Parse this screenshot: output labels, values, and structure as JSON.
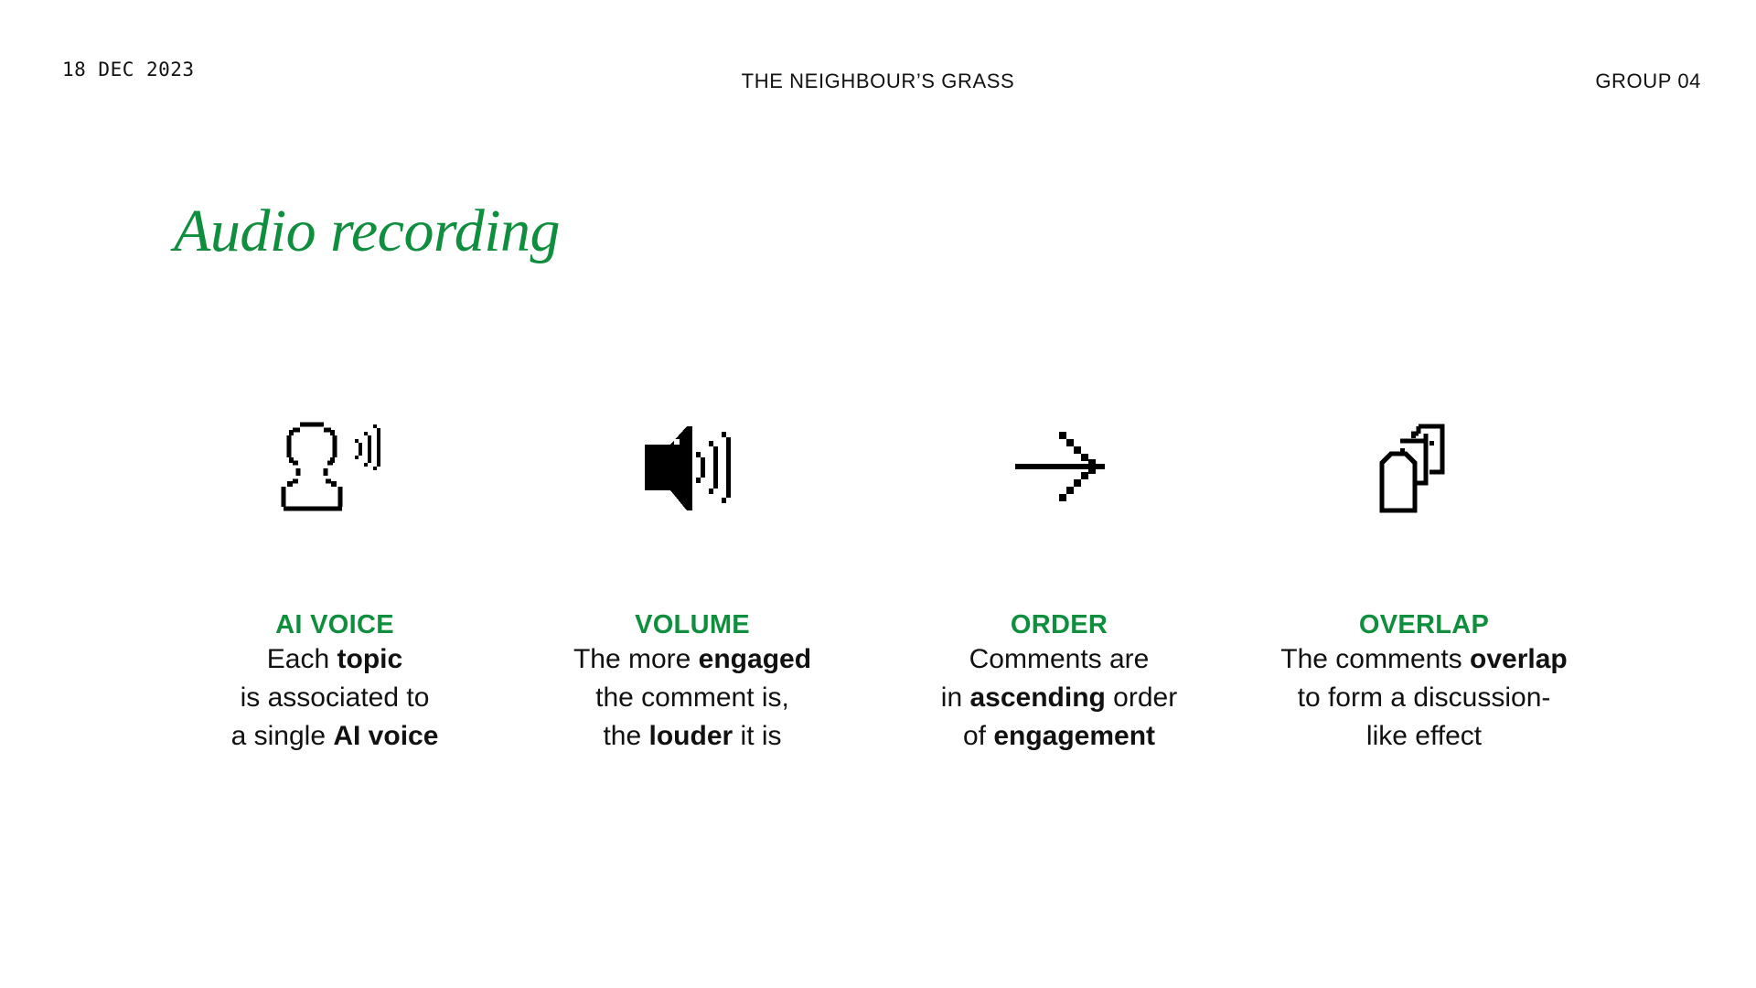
{
  "header": {
    "date": "18  DEC 2023",
    "title": "THE NEIGHBOUR’S GRASS",
    "group": "GROUP 04"
  },
  "title": "Audio recording",
  "colors": {
    "accent": "#0f8f3e",
    "text": "#111111",
    "background": "#ffffff"
  },
  "features": [
    {
      "icon": "speaking-head-icon",
      "heading": "AI VOICE",
      "lines": [
        {
          "pre": "Each ",
          "bold": "topic",
          "post": ""
        },
        {
          "pre": "is associated to",
          "bold": "",
          "post": ""
        },
        {
          "pre": "a single ",
          "bold": "AI voice",
          "post": ""
        }
      ]
    },
    {
      "icon": "speaker-volume-icon",
      "heading": "VOLUME",
      "lines": [
        {
          "pre": "The more ",
          "bold": "engaged",
          "post": ""
        },
        {
          "pre": "the comment is,",
          "bold": "",
          "post": ""
        },
        {
          "pre": "the ",
          "bold": "louder",
          "post": " it is"
        }
      ]
    },
    {
      "icon": "arrow-right-icon",
      "heading": "ORDER",
      "lines": [
        {
          "pre": "Comments are",
          "bold": "",
          "post": ""
        },
        {
          "pre": "in ",
          "bold": "ascending",
          "post": " order"
        },
        {
          "pre": "of ",
          "bold": "engagement",
          "post": ""
        }
      ]
    },
    {
      "icon": "overlapping-pages-icon",
      "heading": "OVERLAP",
      "lines": [
        {
          "pre": "The comments ",
          "bold": "overlap",
          "post": ""
        },
        {
          "pre": "to form a discussion-",
          "bold": "",
          "post": ""
        },
        {
          "pre": "like effect",
          "bold": "",
          "post": ""
        }
      ]
    }
  ]
}
